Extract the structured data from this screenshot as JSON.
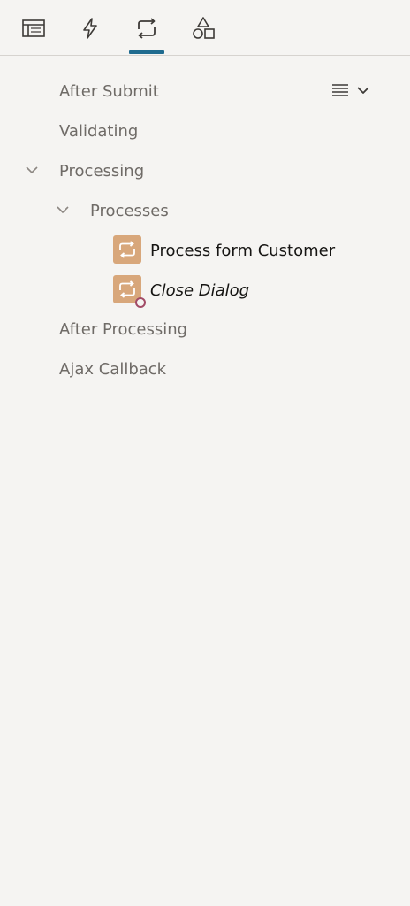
{
  "tabs": [
    {
      "name": "rendering",
      "icon": "layout-icon"
    },
    {
      "name": "dynamic-actions",
      "icon": "lightning-icon"
    },
    {
      "name": "processing",
      "icon": "processing-loop-icon",
      "active": true
    },
    {
      "name": "shared-components",
      "icon": "shapes-icon"
    }
  ],
  "tree": {
    "after_submit": "After Submit",
    "validating": "Validating",
    "processing": "Processing",
    "processes": "Processes",
    "process_form_customer": "Process form Customer",
    "close_dialog": "Close Dialog",
    "after_processing": "After Processing",
    "ajax_callback": "Ajax Callback"
  },
  "toolbar": {
    "menu_icon": "list-menu-icon",
    "dropdown_icon": "chevron-down-icon"
  },
  "colors": {
    "background": "#f5f4f2",
    "active_tab_underline": "#1f6b8f",
    "process_icon_bg": "#d8a77b",
    "badge": "#a24b67"
  }
}
